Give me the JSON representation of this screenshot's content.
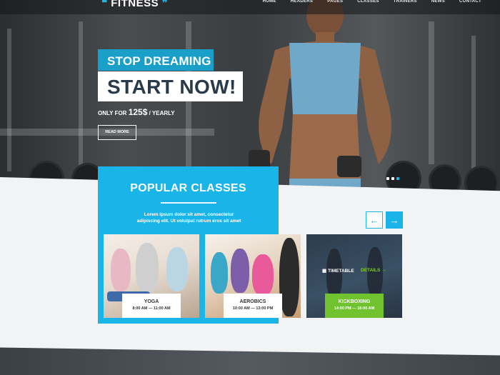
{
  "brand": {
    "logo": "FITNESS",
    "quote_mark": "\""
  },
  "nav": {
    "items": [
      "HOME",
      "HEADERS",
      "PAGES",
      "CLASSES",
      "TRAINERS",
      "NEWS",
      "CONTACT"
    ]
  },
  "hero": {
    "line1": "STOP DREAMING",
    "line2": "START NOW!",
    "price_prefix": "ONLY FOR",
    "price_value": "125$",
    "price_suffix": "/ YEARLY",
    "button": "READ MORE",
    "slides": 3,
    "active_slide": 3
  },
  "classes": {
    "title": "POPULAR CLASSES",
    "description": "Lorem ipsum dolor sit amet, consectetur adipiscing elit. Ut volutpat rutrum eros sit amet",
    "prev_icon": "arrow-left-icon",
    "next_icon": "arrow-right-icon",
    "cards": [
      {
        "name": "YOGA",
        "time": "8:00 AM — 11:00 AM"
      },
      {
        "name": "AEROBICS",
        "time": "10:00 AM — 13:00 PM"
      },
      {
        "name": "KICKBOXING",
        "time": "14:00 PM — 16:00 AM",
        "timetable": "TIMETABLE",
        "details": "DETAILS"
      }
    ]
  },
  "colors": {
    "accent": "#19b5e8",
    "green": "#70c22e",
    "dark_title": "#2a3a48"
  }
}
